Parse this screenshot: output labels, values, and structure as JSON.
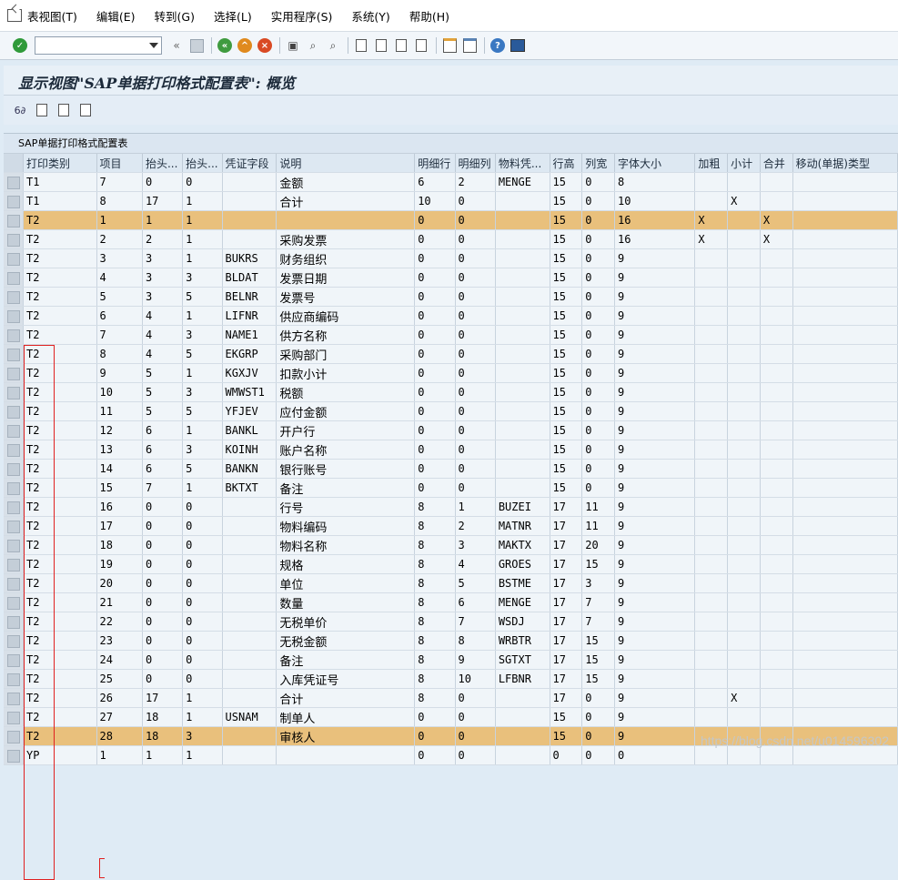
{
  "menu": [
    "表视图(T)",
    "编辑(E)",
    "转到(G)",
    "选择(L)",
    "实用程序(S)",
    "系统(Y)",
    "帮助(H)"
  ],
  "page_title": "显示视图\"SAP单据打印格式配置表\": 概览",
  "table_title": "SAP单据打印格式配置表",
  "columns": [
    "打印类别",
    "项目",
    "抬头...",
    "抬头...",
    "凭证字段",
    "说明",
    "明细行",
    "明细列",
    "物料凭...",
    "行高",
    "列宽",
    "字体大小",
    "加粗",
    "小计",
    "合并",
    "移动(单据)类型"
  ],
  "rows": [
    [
      "T1",
      "7",
      "0",
      "0",
      "",
      "金额",
      "6",
      "2",
      "MENGE",
      "15",
      "0",
      "8",
      "",
      "",
      "",
      ""
    ],
    [
      "T1",
      "8",
      "17",
      "1",
      "",
      "合计",
      "10",
      "0",
      "",
      "15",
      "0",
      "10",
      "",
      "X",
      "",
      ""
    ],
    [
      "T2",
      "1",
      "1",
      "1",
      "",
      "",
      "0",
      "0",
      "",
      "15",
      "0",
      "16",
      "X",
      "",
      "X",
      ""
    ],
    [
      "T2",
      "2",
      "2",
      "1",
      "",
      "采购发票",
      "0",
      "0",
      "",
      "15",
      "0",
      "16",
      "X",
      "",
      "X",
      ""
    ],
    [
      "T2",
      "3",
      "3",
      "1",
      "BUKRS",
      "财务组织",
      "0",
      "0",
      "",
      "15",
      "0",
      "9",
      "",
      "",
      "",
      ""
    ],
    [
      "T2",
      "4",
      "3",
      "3",
      "BLDAT",
      "发票日期",
      "0",
      "0",
      "",
      "15",
      "0",
      "9",
      "",
      "",
      "",
      ""
    ],
    [
      "T2",
      "5",
      "3",
      "5",
      "BELNR",
      "发票号",
      "0",
      "0",
      "",
      "15",
      "0",
      "9",
      "",
      "",
      "",
      ""
    ],
    [
      "T2",
      "6",
      "4",
      "1",
      "LIFNR",
      "供应商编码",
      "0",
      "0",
      "",
      "15",
      "0",
      "9",
      "",
      "",
      "",
      ""
    ],
    [
      "T2",
      "7",
      "4",
      "3",
      "NAME1",
      "供方名称",
      "0",
      "0",
      "",
      "15",
      "0",
      "9",
      "",
      "",
      "",
      ""
    ],
    [
      "T2",
      "8",
      "4",
      "5",
      "EKGRP",
      "采购部门",
      "0",
      "0",
      "",
      "15",
      "0",
      "9",
      "",
      "",
      "",
      ""
    ],
    [
      "T2",
      "9",
      "5",
      "1",
      "KGXJV",
      "扣款小计",
      "0",
      "0",
      "",
      "15",
      "0",
      "9",
      "",
      "",
      "",
      ""
    ],
    [
      "T2",
      "10",
      "5",
      "3",
      "WMWST1",
      "税额",
      "0",
      "0",
      "",
      "15",
      "0",
      "9",
      "",
      "",
      "",
      ""
    ],
    [
      "T2",
      "11",
      "5",
      "5",
      "YFJEV",
      "应付金额",
      "0",
      "0",
      "",
      "15",
      "0",
      "9",
      "",
      "",
      "",
      ""
    ],
    [
      "T2",
      "12",
      "6",
      "1",
      "BANKL",
      "开户行",
      "0",
      "0",
      "",
      "15",
      "0",
      "9",
      "",
      "",
      "",
      ""
    ],
    [
      "T2",
      "13",
      "6",
      "3",
      "KOINH",
      "账户名称",
      "0",
      "0",
      "",
      "15",
      "0",
      "9",
      "",
      "",
      "",
      ""
    ],
    [
      "T2",
      "14",
      "6",
      "5",
      "BANKN",
      "银行账号",
      "0",
      "0",
      "",
      "15",
      "0",
      "9",
      "",
      "",
      "",
      ""
    ],
    [
      "T2",
      "15",
      "7",
      "1",
      "BKTXT",
      "备注",
      "0",
      "0",
      "",
      "15",
      "0",
      "9",
      "",
      "",
      "",
      ""
    ],
    [
      "T2",
      "16",
      "0",
      "0",
      "",
      "行号",
      "8",
      "1",
      "BUZEI",
      "17",
      "11",
      "9",
      "",
      "",
      "",
      ""
    ],
    [
      "T2",
      "17",
      "0",
      "0",
      "",
      "物料编码",
      "8",
      "2",
      "MATNR",
      "17",
      "11",
      "9",
      "",
      "",
      "",
      ""
    ],
    [
      "T2",
      "18",
      "0",
      "0",
      "",
      "物料名称",
      "8",
      "3",
      "MAKTX",
      "17",
      "20",
      "9",
      "",
      "",
      "",
      ""
    ],
    [
      "T2",
      "19",
      "0",
      "0",
      "",
      "规格",
      "8",
      "4",
      "GROES",
      "17",
      "15",
      "9",
      "",
      "",
      "",
      ""
    ],
    [
      "T2",
      "20",
      "0",
      "0",
      "",
      "单位",
      "8",
      "5",
      "BSTME",
      "17",
      "3",
      "9",
      "",
      "",
      "",
      ""
    ],
    [
      "T2",
      "21",
      "0",
      "0",
      "",
      "数量",
      "8",
      "6",
      "MENGE",
      "17",
      "7",
      "9",
      "",
      "",
      "",
      ""
    ],
    [
      "T2",
      "22",
      "0",
      "0",
      "",
      "无税单价",
      "8",
      "7",
      "WSDJ",
      "17",
      "7",
      "9",
      "",
      "",
      "",
      ""
    ],
    [
      "T2",
      "23",
      "0",
      "0",
      "",
      "无税金额",
      "8",
      "8",
      "WRBTR",
      "17",
      "15",
      "9",
      "",
      "",
      "",
      ""
    ],
    [
      "T2",
      "24",
      "0",
      "0",
      "",
      "备注",
      "8",
      "9",
      "SGTXT",
      "17",
      "15",
      "9",
      "",
      "",
      "",
      ""
    ],
    [
      "T2",
      "25",
      "0",
      "0",
      "",
      "入库凭证号",
      "8",
      "10",
      "LFBNR",
      "17",
      "15",
      "9",
      "",
      "",
      "",
      ""
    ],
    [
      "T2",
      "26",
      "17",
      "1",
      "",
      "合计",
      "8",
      "0",
      "",
      "17",
      "0",
      "9",
      "",
      "X",
      "",
      ""
    ],
    [
      "T2",
      "27",
      "18",
      "1",
      "USNAM",
      "制单人",
      "0",
      "0",
      "",
      "15",
      "0",
      "9",
      "",
      "",
      "",
      ""
    ],
    [
      "T2",
      "28",
      "18",
      "3",
      "",
      "审核人",
      "0",
      "0",
      "",
      "15",
      "0",
      "9",
      "",
      "",
      "",
      ""
    ],
    [
      "YP",
      "1",
      "1",
      "1",
      "",
      "",
      "0",
      "0",
      "",
      "0",
      "0",
      "0",
      "",
      "",
      "",
      ""
    ]
  ],
  "highlighted_rows": [
    2,
    29
  ],
  "watermark": "https://blog.csdn.net/u014596302",
  "colors": {
    "highlight": "#e9c07c",
    "annotation": "#e02020"
  }
}
